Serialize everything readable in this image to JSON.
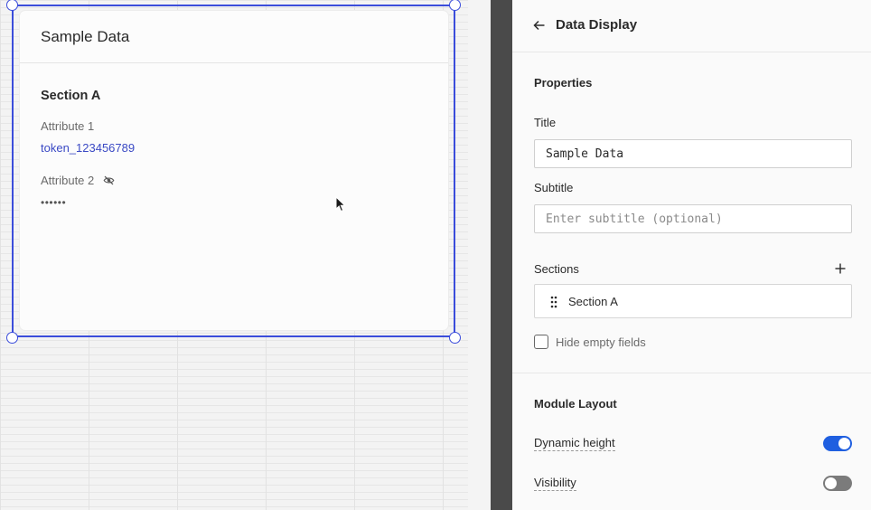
{
  "canvas": {
    "card": {
      "title": "Sample Data",
      "section_title": "Section A",
      "attributes": [
        {
          "label": "Attribute 1",
          "value": "token_123456789"
        },
        {
          "label": "Attribute 2",
          "value": "••••••",
          "hidden_icon": "eye-off-icon"
        }
      ]
    }
  },
  "panel": {
    "header": {
      "title": "Data Display",
      "back_icon": "arrow-left-icon"
    },
    "properties": {
      "heading": "Properties",
      "title_label": "Title",
      "title_value": "Sample Data",
      "subtitle_label": "Subtitle",
      "subtitle_value": "",
      "subtitle_placeholder": "Enter subtitle (optional)",
      "sections_label": "Sections",
      "sections": [
        {
          "label": "Section A"
        }
      ],
      "hide_empty_label": "Hide empty fields",
      "hide_empty_checked": false
    },
    "module_layout": {
      "heading": "Module Layout",
      "dynamic_height_label": "Dynamic height",
      "dynamic_height_on": true,
      "visibility_label": "Visibility",
      "visibility_on": false
    }
  },
  "colors": {
    "selection": "#3b4ddb",
    "link": "#3a49c4",
    "toggle_on": "#1f5fe0",
    "toggle_off": "#7b7b7b"
  }
}
